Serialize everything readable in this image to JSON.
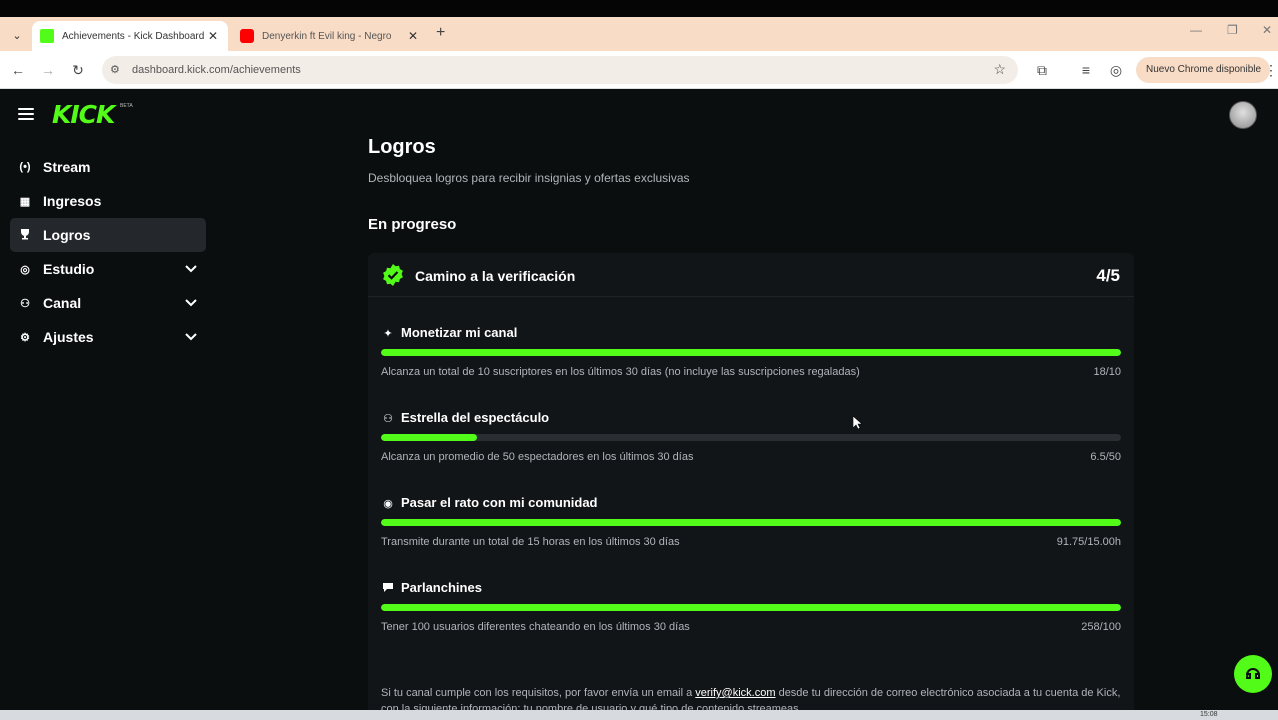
{
  "browser": {
    "tabs": [
      {
        "title": "Achievements - Kick Dashboard",
        "active": true
      },
      {
        "title": "Denyerkin ft Evil king - Negro",
        "active": false
      }
    ],
    "url": "dashboard.kick.com/achievements",
    "update_label": "Nuevo Chrome disponible"
  },
  "app": {
    "logo_text": "KICK",
    "logo_badge": "BETA",
    "brand_color": "#53fc18"
  },
  "sidebar": {
    "items": [
      {
        "label": "Stream",
        "icon": "broadcast-icon",
        "glyph": "(•)",
        "active": false,
        "expandable": false
      },
      {
        "label": "Ingresos",
        "icon": "chart-icon",
        "glyph": "▦",
        "active": false,
        "expandable": false
      },
      {
        "label": "Logros",
        "icon": "trophy-icon",
        "glyph": "🏆",
        "active": true,
        "expandable": false
      },
      {
        "label": "Estudio",
        "icon": "studio-icon",
        "glyph": "◎",
        "active": false,
        "expandable": true
      },
      {
        "label": "Canal",
        "icon": "channel-icon",
        "glyph": "⚇",
        "active": false,
        "expandable": true
      },
      {
        "label": "Ajustes",
        "icon": "gear-icon",
        "glyph": "⚙",
        "active": false,
        "expandable": true
      }
    ]
  },
  "page": {
    "title": "Logros",
    "subtitle": "Desbloquea logros para recibir insignias y ofertas exclusivas",
    "section_title": "En progreso",
    "card": {
      "title": "Camino a la verificación",
      "count": "4/5",
      "tasks": [
        {
          "title": "Monetizar mi canal",
          "icon": "sparkle-icon",
          "glyph": "✦",
          "desc": "Alcanza un total de 10 suscriptores en los últimos 30 días (no incluye las suscripciones regaladas)",
          "value": "18/10",
          "progress": 1.0
        },
        {
          "title": "Estrella del espectáculo",
          "icon": "users-icon",
          "glyph": "⚇",
          "desc": "Alcanza un promedio de 50 espectadores en los últimos 30 días",
          "value": "6.5/50",
          "progress": 0.13
        },
        {
          "title": "Pasar el rato con mi comunidad",
          "icon": "broadcast-icon",
          "glyph": "◉",
          "desc": "Transmite durante un total de 15 horas en los últimos 30 días",
          "value": "91.75/15.00h",
          "progress": 1.0
        },
        {
          "title": "Parlanchines",
          "icon": "chat-icon",
          "glyph": "💬",
          "desc": "Tener 100 usuarios diferentes chateando en los últimos 30 días",
          "value": "258/100",
          "progress": 1.0
        }
      ]
    },
    "note": {
      "before": "Si tu canal cumple con los requisitos, por favor envía un email a ",
      "email": "verify@kick.com",
      "after": " desde tu dirección de correo electrónico asociada a tu cuenta de Kick, con la siguiente información: tu nombre de usuario y qué tipo de contenido streameas."
    }
  },
  "taskbar": {
    "clock": "15:08"
  }
}
